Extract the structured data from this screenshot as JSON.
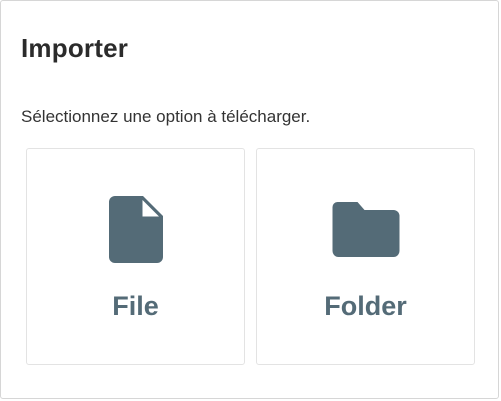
{
  "dialog": {
    "title": "Importer",
    "subtitle": "Sélectionnez une option à télécharger."
  },
  "options": [
    {
      "label": "File",
      "icon": "file-icon"
    },
    {
      "label": "Folder",
      "icon": "folder-icon"
    }
  ],
  "colors": {
    "icon": "#546b77",
    "label": "#546b77",
    "title": "#2b2b2b",
    "text": "#333333",
    "card_border": "#e3e3e3"
  }
}
